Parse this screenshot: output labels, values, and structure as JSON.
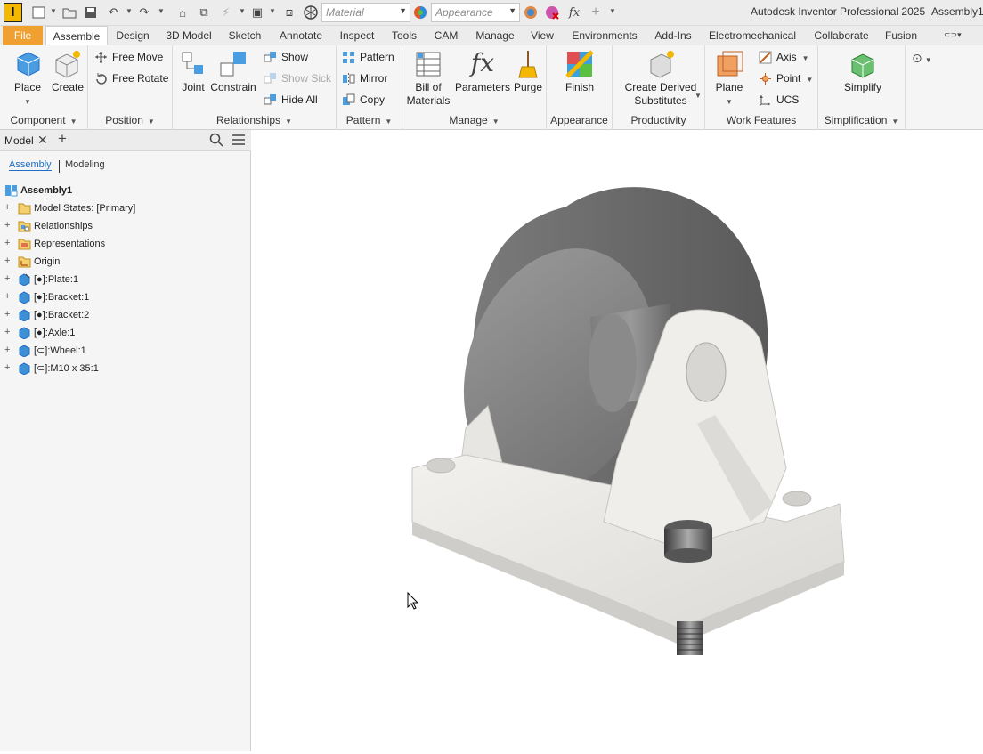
{
  "app": {
    "title": "Autodesk Inventor Professional 2025",
    "document": "Assembly1",
    "logo_letter": "I"
  },
  "quick_access": {
    "material_placeholder": "Material",
    "appearance_placeholder": "Appearance",
    "fx_label": "fx"
  },
  "tabs": [
    "File",
    "Assemble",
    "Design",
    "3D Model",
    "Sketch",
    "Annotate",
    "Inspect",
    "Tools",
    "CAM",
    "Manage",
    "View",
    "Environments",
    "Add-Ins",
    "Electromechanical",
    "Collaborate",
    "Fusion"
  ],
  "ribbon": {
    "component": {
      "label": "Component",
      "place": "Place",
      "create": "Create"
    },
    "position": {
      "label": "Position",
      "free_move": "Free Move",
      "free_rotate": "Free Rotate"
    },
    "relationships": {
      "label": "Relationships",
      "joint": "Joint",
      "constrain": "Constrain",
      "show": "Show",
      "show_sick": "Show Sick",
      "hide_all": "Hide All"
    },
    "pattern": {
      "label": "Pattern",
      "pattern": "Pattern",
      "mirror": "Mirror",
      "copy": "Copy"
    },
    "manage": {
      "label": "Manage",
      "bom_line1": "Bill of",
      "bom_line2": "Materials",
      "parameters": "Parameters",
      "purge": "Purge"
    },
    "appearance": {
      "label": "Appearance",
      "finish": "Finish"
    },
    "productivity": {
      "label": "Productivity",
      "derived_line1": "Create Derived",
      "derived_line2": "Substitutes"
    },
    "work_features": {
      "label": "Work Features",
      "plane": "Plane",
      "axis": "Axis",
      "point": "Point",
      "ucs": "UCS"
    },
    "simplification": {
      "label": "Simplification",
      "simplify": "Simplify"
    }
  },
  "browser": {
    "tab_label": "Model",
    "subtab_assembly": "Assembly",
    "subtab_modeling": "Modeling",
    "root": "Assembly1",
    "items": [
      {
        "label": "Model States: [Primary]",
        "icon": "folder-icon"
      },
      {
        "label": "Relationships",
        "icon": "relationships-icon"
      },
      {
        "label": "Representations",
        "icon": "representations-icon"
      },
      {
        "label": "Origin",
        "icon": "origin-icon"
      },
      {
        "label": "[●]:Plate:1",
        "icon": "part-icon"
      },
      {
        "label": "[●]:Bracket:1",
        "icon": "part-icon"
      },
      {
        "label": "[●]:Bracket:2",
        "icon": "part-icon"
      },
      {
        "label": "[●]:Axle:1",
        "icon": "part-icon"
      },
      {
        "label": "[⊂]:Wheel:1",
        "icon": "part-icon"
      },
      {
        "label": "[⊂]:M10 x 35:1",
        "icon": "part-icon"
      }
    ]
  },
  "colors": {
    "file_tab": "#f0a030",
    "accent_blue": "#1f6fc5",
    "part_blue": "#3d8fd6"
  }
}
